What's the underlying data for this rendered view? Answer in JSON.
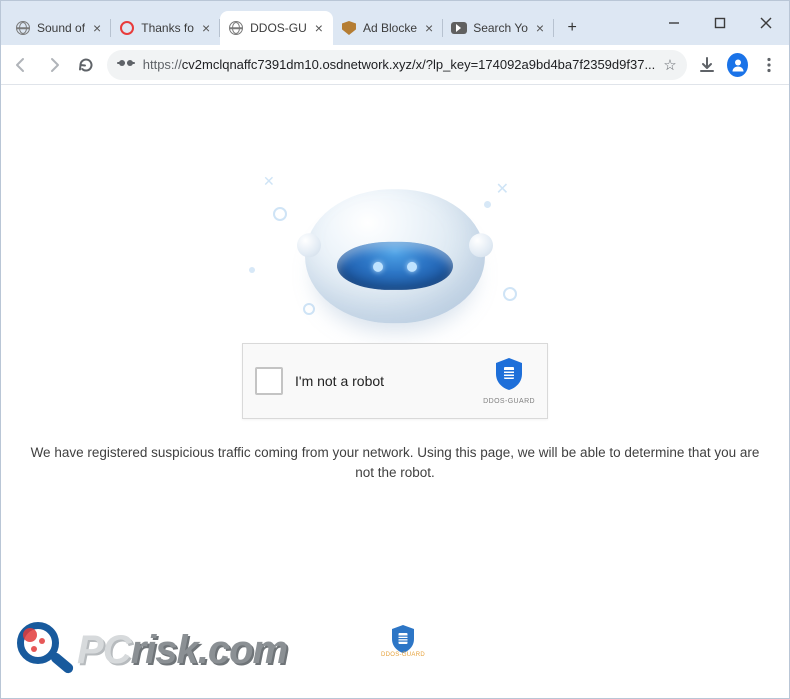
{
  "tabs": [
    {
      "title": "Sound of",
      "icon": "globe"
    },
    {
      "title": "Thanks fo",
      "icon": "opera"
    },
    {
      "title": "DDOS-GU",
      "icon": "globe",
      "active": true
    },
    {
      "title": "Ad Blocke",
      "icon": "shield"
    },
    {
      "title": "Search Yo",
      "icon": "youtube"
    }
  ],
  "address": {
    "scheme": "https://",
    "host_and_path": "cv2mclqnaffc7391dm10.osdnetwork.xyz/x/?lp_key=174092a9bd4ba7f2359d9f37..."
  },
  "captcha": {
    "label": "I'm not a robot",
    "brand": "DDOS-GUARD"
  },
  "notice": "We have registered suspicious traffic coming from your network. Using this page, we will be able to determine that you are not the robot.",
  "watermark": {
    "p": "P",
    "c": "C",
    "rest": "risk.com"
  },
  "float_brand": "DDOS-GUARD",
  "colors": {
    "accent": "#1e6fd9"
  }
}
